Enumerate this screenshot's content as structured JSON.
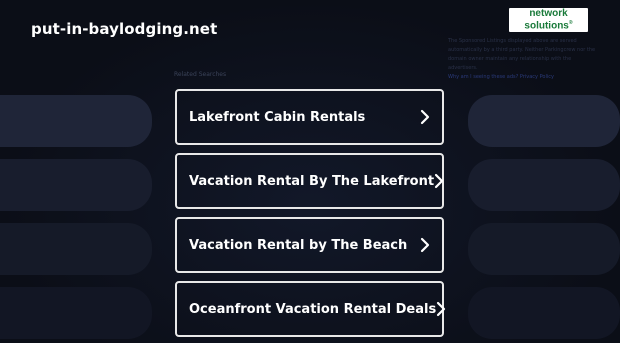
{
  "header": {
    "domain": "put-in-baylodging.net",
    "logo_line1": "network",
    "logo_line2": "solutions",
    "logo_mark": "®"
  },
  "notice": {
    "text": "The Sponsored Listings displayed above are served automatically by a third party. Neither Parkingcrew nor the domain owner maintain any relationship with the advertisers.",
    "link": "Why am I seeing these ads? Privacy Policy"
  },
  "related": {
    "label": "Related Searches"
  },
  "links": [
    {
      "label": "Lakefront Cabin Rentals",
      "icon": "chevron-right-icon"
    },
    {
      "label": "Vacation Rental By The Lakefront",
      "icon": "chevron-right-icon"
    },
    {
      "label": "Vacation Rental by The Beach",
      "icon": "chevron-right-icon"
    },
    {
      "label": "Oceanfront Vacation Rental Deals",
      "icon": "chevron-right-icon"
    }
  ],
  "colors": {
    "background": "#0b0e17",
    "button_border": "#e8e8e8",
    "logo_green": "#1a7a3a"
  }
}
